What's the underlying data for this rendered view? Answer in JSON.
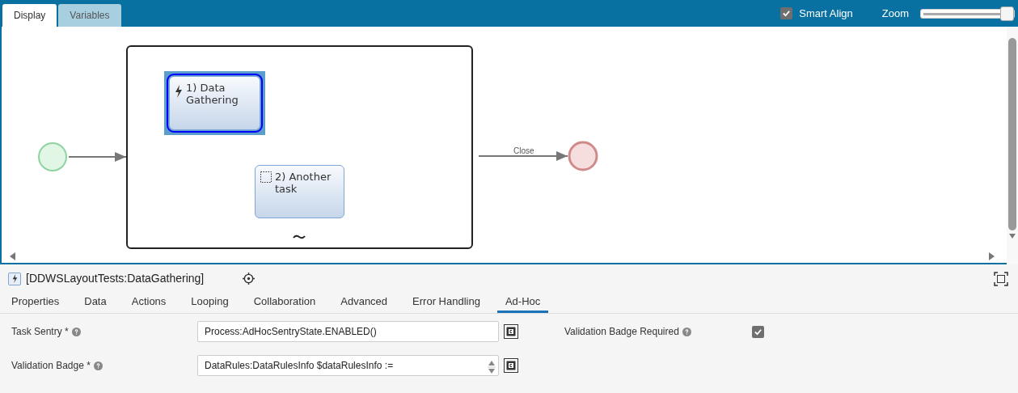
{
  "tabs": [
    {
      "label": "Display",
      "selected": true
    },
    {
      "label": "Variables",
      "selected": false
    }
  ],
  "smart_align": {
    "label": "Smart Align",
    "checked": true
  },
  "zoom": {
    "label": "Zoom",
    "level": 0.97
  },
  "diagram": {
    "tasks": [
      {
        "label": "1) Data Gathering",
        "kind": "triggered",
        "selected": true
      },
      {
        "label": "2) Another task",
        "kind": "empty",
        "selected": false
      }
    ],
    "flow_label": "Close"
  },
  "details": {
    "title": "[DDWSLayoutTests:DataGathering]",
    "tabs": [
      {
        "label": "Properties",
        "selected": false
      },
      {
        "label": "Data",
        "selected": false
      },
      {
        "label": "Actions",
        "selected": false
      },
      {
        "label": "Looping",
        "selected": false
      },
      {
        "label": "Collaboration",
        "selected": false
      },
      {
        "label": "Advanced",
        "selected": false
      },
      {
        "label": "Error Handling",
        "selected": false
      },
      {
        "label": "Ad-Hoc",
        "selected": true
      }
    ],
    "task_sentry": {
      "label": "Task Sentry *",
      "value": "Process:AdHocSentryState.ENABLED()"
    },
    "validation_badge": {
      "label": "Validation Badge *",
      "value": "DataRules:DataRulesInfo $dataRulesInfo :="
    },
    "badge_required": {
      "label": "Validation Badge Required",
      "checked": true
    }
  }
}
